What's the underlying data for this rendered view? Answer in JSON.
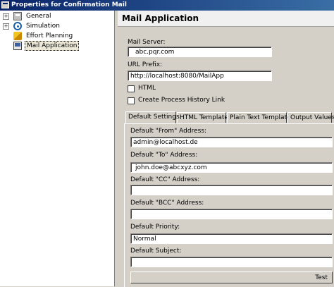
{
  "window": {
    "title": "Properties for Confirmation Mail"
  },
  "tree": {
    "items": [
      {
        "label": "General",
        "icon": "general-icon",
        "expander": "+"
      },
      {
        "label": "Simulation",
        "icon": "simulation-icon",
        "expander": "+"
      },
      {
        "label": "Effort Planning",
        "icon": "effort-planning-icon",
        "expander": ""
      },
      {
        "label": "Mail Application",
        "icon": "mail-application-icon",
        "expander": "",
        "selected": true
      }
    ]
  },
  "page": {
    "header": "Mail Application"
  },
  "form": {
    "mail_server_label": "Mail Server:",
    "mail_server_value": "abc.pqr.com",
    "url_prefix_label": "URL Prefix:",
    "url_prefix_value": "http://localhost:8080/MailApp",
    "html_label": "HTML",
    "history_link_label": "Create Process History Link"
  },
  "tabs": [
    {
      "label": "Default Settings",
      "active": true
    },
    {
      "label": "HTML Template"
    },
    {
      "label": "Plain Text Template"
    },
    {
      "label": "Output Values"
    }
  ],
  "defaults": {
    "from_label": "Default \"From\" Address:",
    "from_value": "admin@localhost.de",
    "to_label": "Default \"To\" Address:",
    "to_value": "john.doe@abcxyz.com",
    "cc_label": "Default \"CC\" Address:",
    "cc_value": "",
    "bcc_label": "Default \"BCC\" Address:",
    "bcc_value": "",
    "priority_label": "Default Priority:",
    "priority_value": "Normal",
    "subject_label": "Default Subject:",
    "subject_value": "",
    "test_button": "Test"
  },
  "colors": {
    "title_bar": "#0a246a",
    "face": "#d4d0c8",
    "tree_background": "#ffffff"
  }
}
